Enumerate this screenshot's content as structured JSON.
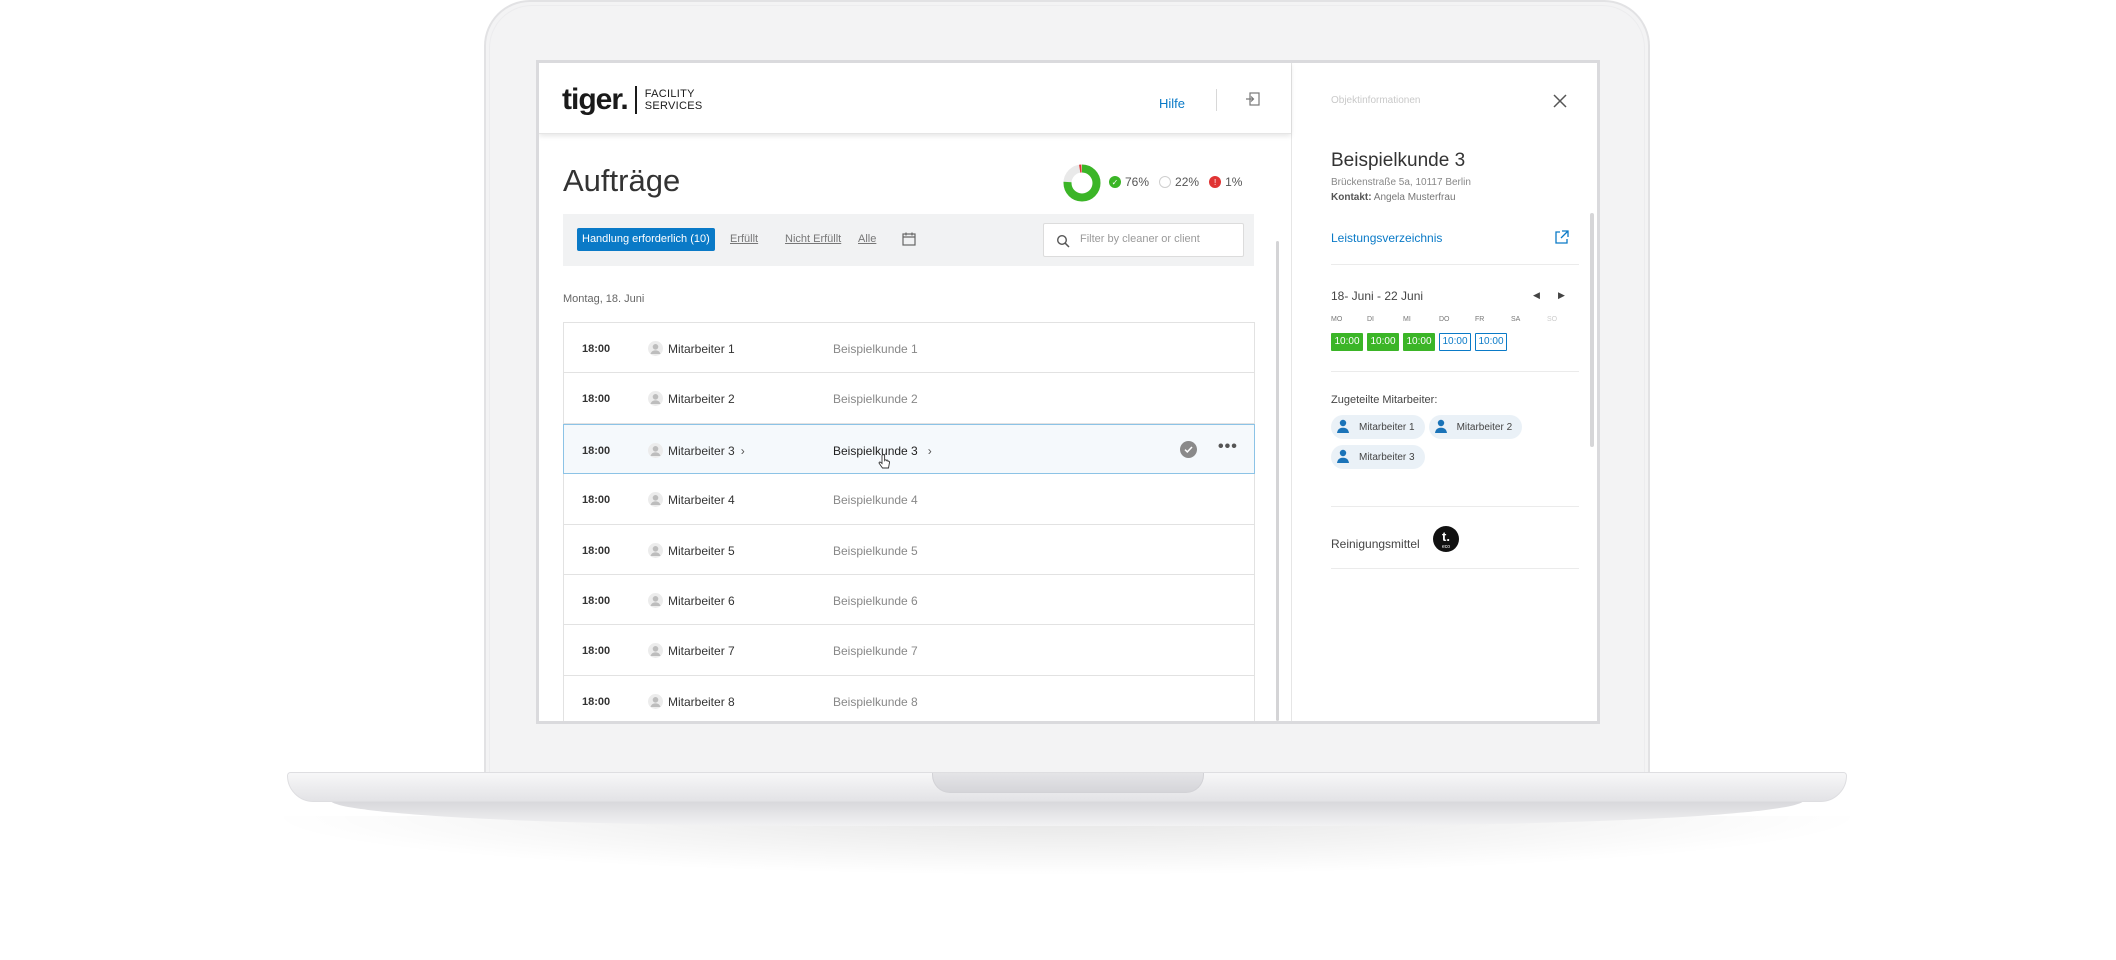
{
  "header": {
    "logo_word": "tiger.",
    "logo_sub_1": "FACILITY",
    "logo_sub_2": "SERVICES",
    "help": "Hilfe"
  },
  "page": {
    "title": "Aufträge",
    "stats": [
      {
        "label": "76%",
        "status": "fulfilled",
        "color": "#3bb527",
        "fraction": 0.76
      },
      {
        "label": "22%",
        "status": "open",
        "color": "#ffffff",
        "fraction": 0.22
      },
      {
        "label": "1%",
        "status": "failed",
        "color": "#e03434",
        "fraction": 0.01
      }
    ]
  },
  "filters": {
    "active": "Handlung erforderlich (10)",
    "links": [
      "Erfüllt",
      "Nicht Erfüllt",
      "Alle"
    ],
    "search_placeholder": "Filter by cleaner or client"
  },
  "list": {
    "date": "Montag, 18. Juni",
    "rows": [
      {
        "time": "18:00",
        "employee": "Mitarbeiter 1",
        "client": "Beispielkunde 1"
      },
      {
        "time": "18:00",
        "employee": "Mitarbeiter 2",
        "client": "Beispielkunde 2"
      },
      {
        "time": "18:00",
        "employee": "Mitarbeiter 3",
        "client": "Beispielkunde 3",
        "active": true
      },
      {
        "time": "18:00",
        "employee": "Mitarbeiter 4",
        "client": "Beispielkunde 4"
      },
      {
        "time": "18:00",
        "employee": "Mitarbeiter 5",
        "client": "Beispielkunde 5"
      },
      {
        "time": "18:00",
        "employee": "Mitarbeiter 6",
        "client": "Beispielkunde 6"
      },
      {
        "time": "18:00",
        "employee": "Mitarbeiter 7",
        "client": "Beispielkunde 7"
      },
      {
        "time": "18:00",
        "employee": "Mitarbeiter 8",
        "client": "Beispielkunde 8"
      }
    ]
  },
  "panel": {
    "title": "Objektinformationen",
    "client_name": "Beispielkunde 3",
    "address": "Brückenstraße 5a, 10117 Berlin",
    "contact_label": "Kontakt:",
    "contact_name": "Angela Musterfrau",
    "link": "Leistungsverzeichnis",
    "week": "18- Juni - 22 Juni",
    "days": [
      "MO",
      "DI",
      "MI",
      "DO",
      "FR",
      "SA",
      "SO"
    ],
    "times": [
      {
        "label": "10:00",
        "state": "done"
      },
      {
        "label": "10:00",
        "state": "done"
      },
      {
        "label": "10:00",
        "state": "done"
      },
      {
        "label": "10:00",
        "state": "open"
      },
      {
        "label": "10:00",
        "state": "open"
      }
    ],
    "assigned_label": "Zugeteilte Mitarbeiter:",
    "assigned": [
      "Mitarbeiter 1",
      "Mitarbeiter 2",
      "Mitarbeiter 3"
    ],
    "cleaning_label": "Reinigungsmittel",
    "badge_letter": "t.",
    "badge_sub": "eco"
  },
  "colors": {
    "accent": "#0a7ac7",
    "success": "#3bb527",
    "error": "#e03434"
  }
}
